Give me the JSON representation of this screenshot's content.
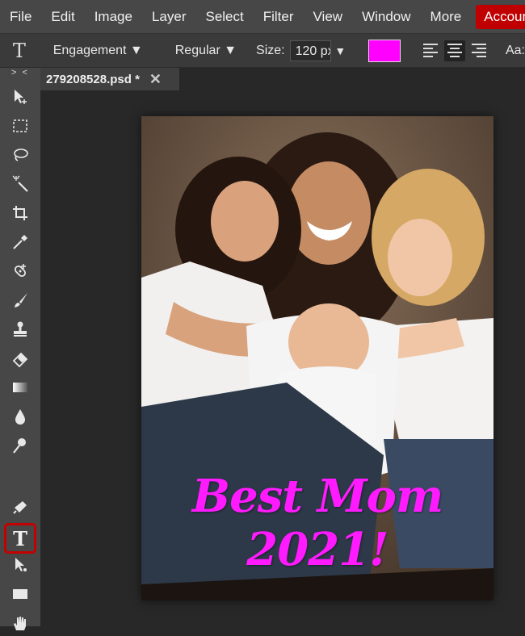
{
  "menubar": {
    "items": [
      "File",
      "Edit",
      "Image",
      "Layer",
      "Select",
      "Filter",
      "View",
      "Window",
      "More"
    ],
    "account_label": "Accoun"
  },
  "options": {
    "font": "Engagement ▼",
    "style": "Regular ▼",
    "size_label": "Size:",
    "size_value": "120 px",
    "size_arrow": "▼",
    "text_color": "#ff00ff",
    "aa_label": "Aa:"
  },
  "toolbox": {
    "collapse": "> <",
    "tools": [
      "move-tool",
      "marquee-tool",
      "lasso-tool",
      "magic-wand-tool",
      "crop-tool",
      "eyedropper-tool",
      "healing-tool",
      "brush-tool",
      "stamp-tool",
      "eraser-tool",
      "gradient-tool",
      "blur-tool",
      "dodge-tool",
      "type-tool",
      "pen-tool",
      "path-select-tool",
      "shape-tool",
      "hand-tool",
      "zoom-tool"
    ],
    "selected_tool": "type-tool",
    "type_glyph": "T"
  },
  "document": {
    "tab_title": "279208528.psd *",
    "tab_close": "✕",
    "canvas_text": "Best Mom 2021!",
    "canvas_text_color": "#ff1aff"
  }
}
